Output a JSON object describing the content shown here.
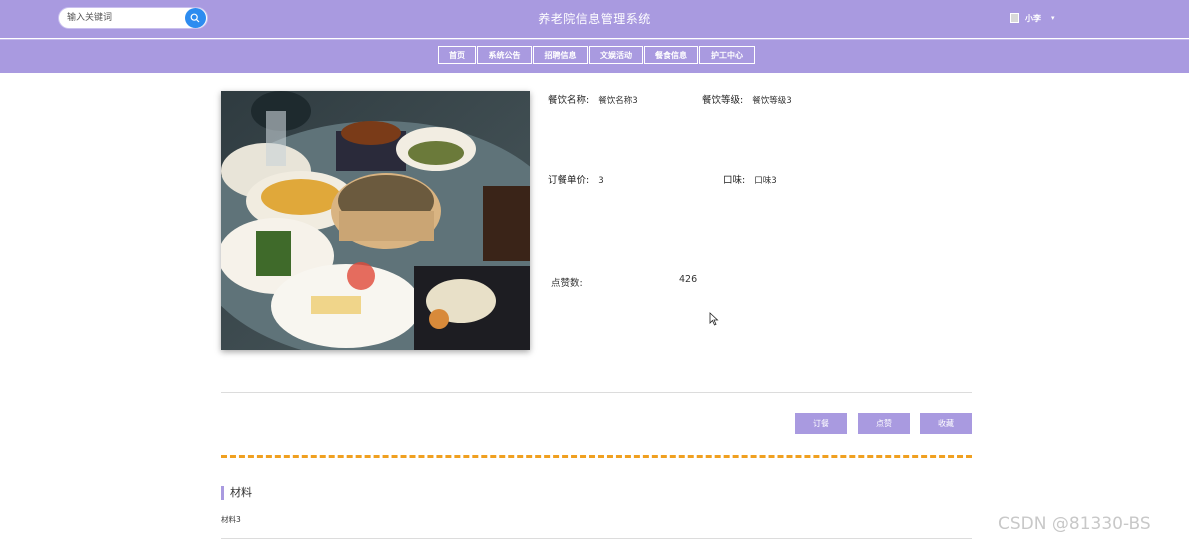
{
  "header": {
    "search_placeholder": "输入关键词",
    "site_title": "养老院信息管理系统",
    "username": "小李",
    "caret": "▾"
  },
  "nav": {
    "items": [
      {
        "label": "首页"
      },
      {
        "label": "系统公告"
      },
      {
        "label": "招聘信息"
      },
      {
        "label": "文娱活动"
      },
      {
        "label": "餐食信息"
      },
      {
        "label": "护工中心"
      }
    ]
  },
  "detail": {
    "name_label": "餐饮名称:",
    "name_value": "餐饮名称3",
    "level_label": "餐饮等级:",
    "level_value": "餐饮等级3",
    "price_label": "订餐单价:",
    "price_value": "3",
    "taste_label": "口味:",
    "taste_value": "口味3",
    "likes_label": "点赞数:",
    "likes_value": "426"
  },
  "actions": {
    "order_label": "订餐",
    "like_label": "点赞",
    "favorite_label": "收藏"
  },
  "material": {
    "title": "材料",
    "content": "材料3"
  },
  "watermark": "CSDN @81330-BS",
  "colors": {
    "header_bg": "#a99ae0",
    "search_btn": "#2d8cf0",
    "dash_line": "#f0a020"
  }
}
